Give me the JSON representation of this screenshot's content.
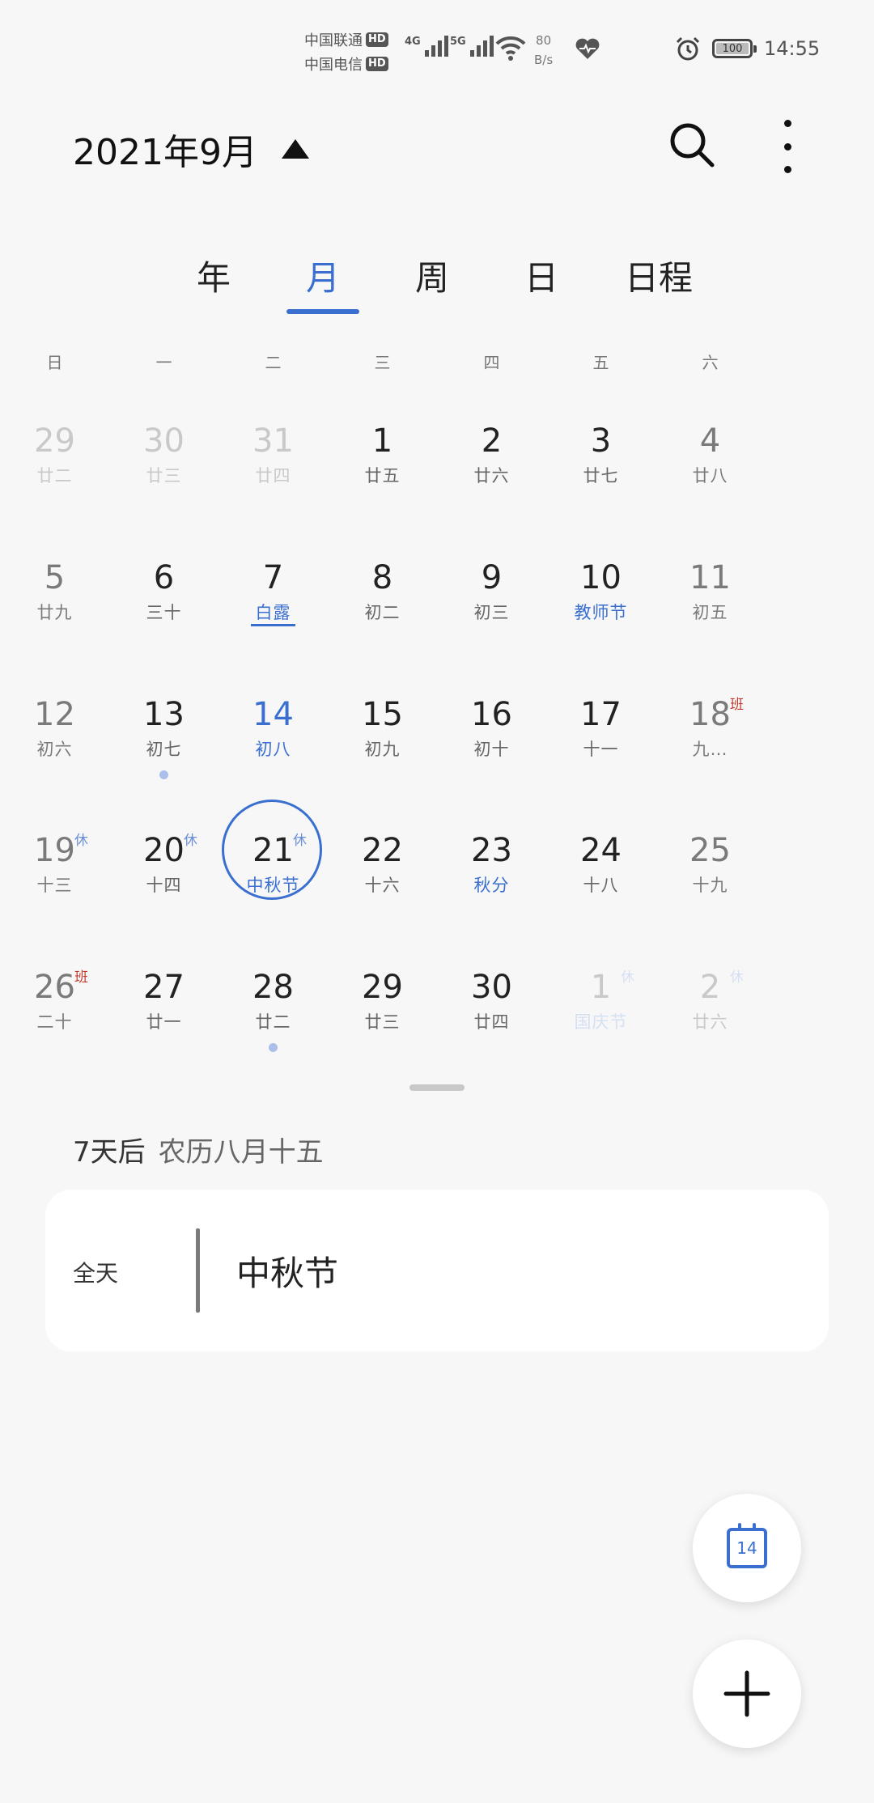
{
  "status_bar": {
    "carrier1": "中国联通",
    "carrier2": "中国电信",
    "hd": "HD",
    "net1": "4G",
    "net2": "5G",
    "speed_value": "80",
    "speed_unit": "B/s",
    "battery": "100",
    "time": "14:55"
  },
  "header": {
    "title": "2021年9月"
  },
  "tabs": [
    {
      "label": "年",
      "active": false
    },
    {
      "label": "月",
      "active": true
    },
    {
      "label": "周",
      "active": false
    },
    {
      "label": "日",
      "active": false
    },
    {
      "label": "日程",
      "active": false
    }
  ],
  "weekdays": [
    "日",
    "一",
    "二",
    "三",
    "四",
    "五",
    "六"
  ],
  "weeks": [
    [
      {
        "day": "29",
        "lunar": "廿二",
        "faded": true
      },
      {
        "day": "30",
        "lunar": "廿三",
        "faded": true
      },
      {
        "day": "31",
        "lunar": "廿四",
        "faded": true
      },
      {
        "day": "1",
        "lunar": "廿五"
      },
      {
        "day": "2",
        "lunar": "廿六"
      },
      {
        "day": "3",
        "lunar": "廿七"
      },
      {
        "day": "4",
        "lunar": "廿八"
      }
    ],
    [
      {
        "day": "5",
        "lunar": "廿九"
      },
      {
        "day": "6",
        "lunar": "三十"
      },
      {
        "day": "7",
        "lunar": "白露",
        "lunar_blue": true,
        "underline": true
      },
      {
        "day": "8",
        "lunar": "初二"
      },
      {
        "day": "9",
        "lunar": "初三"
      },
      {
        "day": "10",
        "lunar": "教师节",
        "lunar_blue": true
      },
      {
        "day": "11",
        "lunar": "初五"
      }
    ],
    [
      {
        "day": "12",
        "lunar": "初六"
      },
      {
        "day": "13",
        "lunar": "初七",
        "dot": true
      },
      {
        "day": "14",
        "lunar": "初八",
        "day_blue": true,
        "lunar_blue": true
      },
      {
        "day": "15",
        "lunar": "初九"
      },
      {
        "day": "16",
        "lunar": "初十"
      },
      {
        "day": "17",
        "lunar": "十一"
      },
      {
        "day": "18",
        "lunar": "九…",
        "lunar_blue": true,
        "tag": "班",
        "tag_type": "work"
      }
    ],
    [
      {
        "day": "19",
        "lunar": "十三",
        "tag": "休",
        "tag_type": "rest"
      },
      {
        "day": "20",
        "lunar": "十四",
        "tag": "休",
        "tag_type": "rest"
      },
      {
        "day": "21",
        "lunar": "中秋节",
        "lunar_blue": true,
        "tag": "休",
        "tag_type": "rest",
        "selected": true
      },
      {
        "day": "22",
        "lunar": "十六"
      },
      {
        "day": "23",
        "lunar": "秋分",
        "lunar_blue": true
      },
      {
        "day": "24",
        "lunar": "十八"
      },
      {
        "day": "25",
        "lunar": "十九"
      }
    ],
    [
      {
        "day": "26",
        "lunar": "二十",
        "tag": "班",
        "tag_type": "work"
      },
      {
        "day": "27",
        "lunar": "廿一"
      },
      {
        "day": "28",
        "lunar": "廿二",
        "dot": true
      },
      {
        "day": "29",
        "lunar": "廿三"
      },
      {
        "day": "30",
        "lunar": "廿四"
      },
      {
        "day": "1",
        "lunar": "国庆节",
        "faded": true,
        "lunar_blue": true,
        "tag": "休",
        "tag_type": "rest"
      },
      {
        "day": "2",
        "lunar": "廿六",
        "faded": true,
        "tag": "休",
        "tag_type": "rest"
      }
    ]
  ],
  "info": {
    "days_after": "7天后",
    "lunar_date": "农历八月十五"
  },
  "event": {
    "allday": "全天",
    "title": "中秋节"
  },
  "fab_today": {
    "label": "14"
  },
  "colors": {
    "accent": "#3a6fd0",
    "work_tag": "#c0392b"
  }
}
